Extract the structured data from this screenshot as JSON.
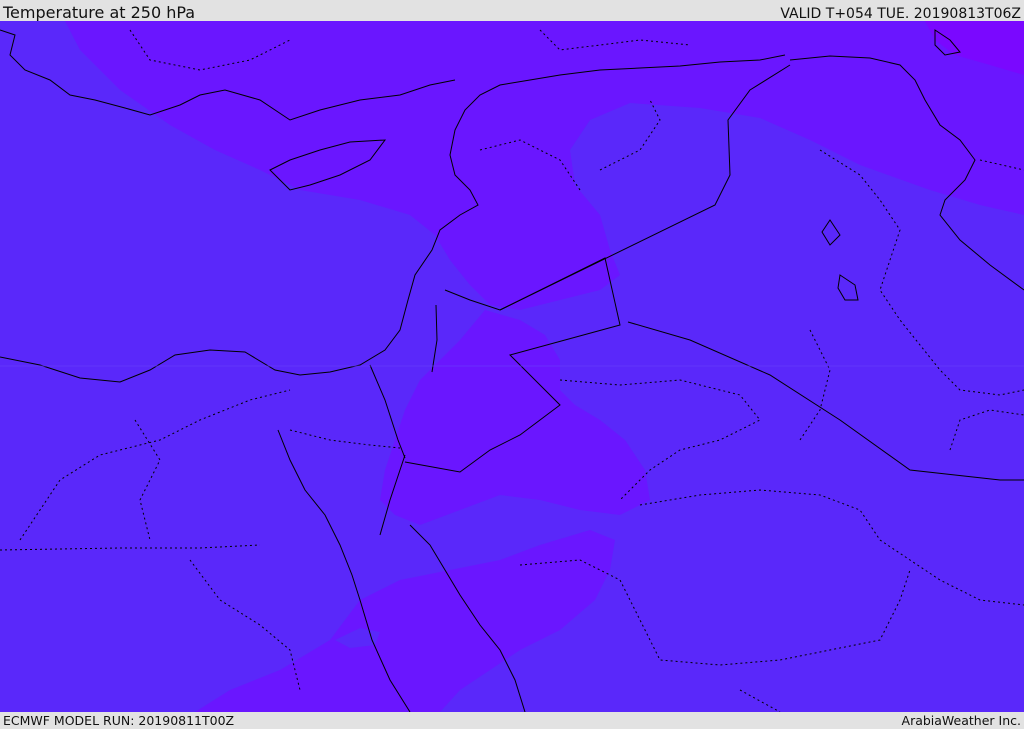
{
  "header": {
    "title": "Temperature at 250 hPa",
    "valid_time": "VALID T+054 TUE. 20190813T06Z"
  },
  "footer": {
    "model_run": "ECMWF MODEL RUN: 20190811T00Z",
    "credit": "ArabiaWeather Inc."
  },
  "colors": {
    "base_field": "#5a28fa",
    "warm_band": "#6a16ff",
    "warmest_spot": "#7a08ff",
    "header_bg": "#e2e2e2"
  }
}
